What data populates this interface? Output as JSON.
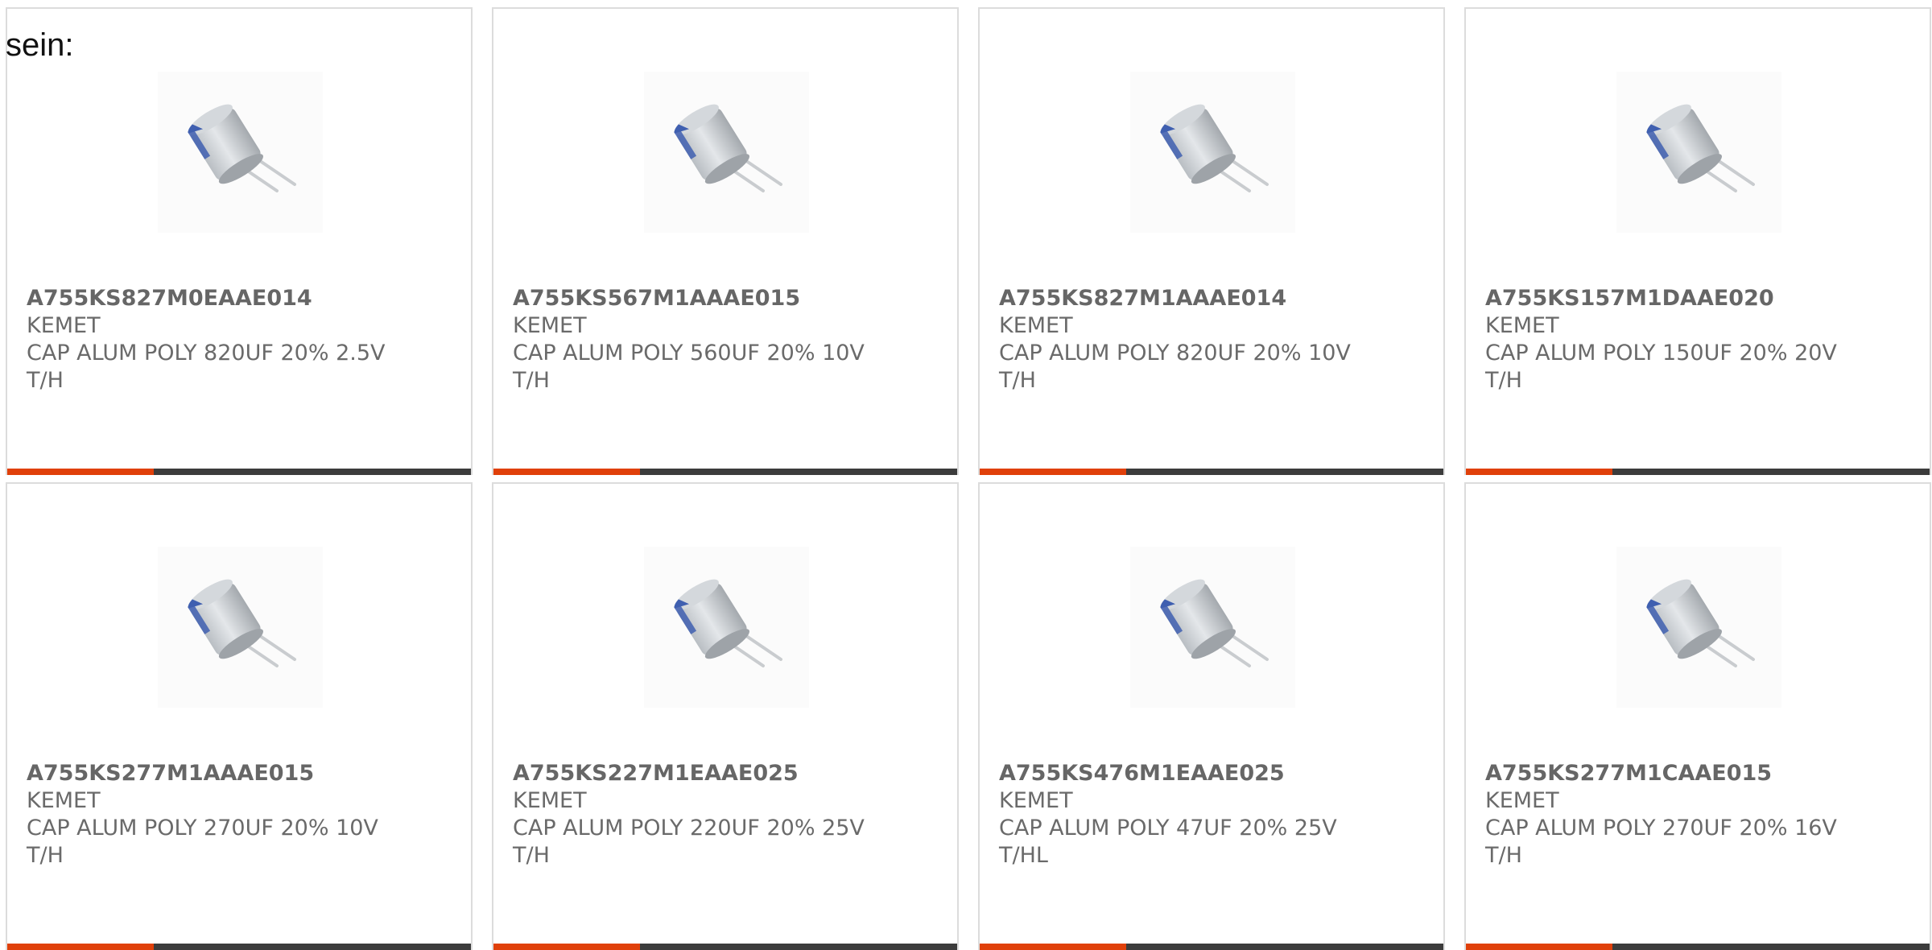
{
  "intro_text": "sein:",
  "colors": {
    "accent": "#e0400a",
    "bar": "#3c3c3c",
    "card_border": "#dcdcdc",
    "text": "#6a6a6a",
    "capacitor_mark": "#3f5fb0"
  },
  "product_image_icon": "capacitor-icon",
  "products": [
    {
      "part_number": "A755KS827M0EAAE014",
      "manufacturer": "KEMET",
      "description": "CAP ALUM POLY 820UF 20% 2.5V",
      "mount": "T/H"
    },
    {
      "part_number": "A755KS567M1AAAE015",
      "manufacturer": "KEMET",
      "description": "CAP ALUM POLY 560UF 20% 10V",
      "mount": "T/H"
    },
    {
      "part_number": "A755KS827M1AAAE014",
      "manufacturer": "KEMET",
      "description": "CAP ALUM POLY 820UF 20% 10V",
      "mount": "T/H"
    },
    {
      "part_number": "A755KS157M1DAAE020",
      "manufacturer": "KEMET",
      "description": "CAP ALUM POLY 150UF 20% 20V",
      "mount": "T/H"
    },
    {
      "part_number": "A755KS277M1AAAE015",
      "manufacturer": "KEMET",
      "description": "CAP ALUM POLY 270UF 20% 10V",
      "mount": "T/H"
    },
    {
      "part_number": "A755KS227M1EAAE025",
      "manufacturer": "KEMET",
      "description": "CAP ALUM POLY 220UF 20% 25V",
      "mount": "T/H"
    },
    {
      "part_number": "A755KS476M1EAAE025",
      "manufacturer": "KEMET",
      "description": "CAP ALUM POLY 47UF 20% 25V",
      "mount": "T/HL"
    },
    {
      "part_number": "A755KS277M1CAAE015",
      "manufacturer": "KEMET",
      "description": "CAP ALUM POLY 270UF 20% 16V",
      "mount": "T/H"
    }
  ]
}
